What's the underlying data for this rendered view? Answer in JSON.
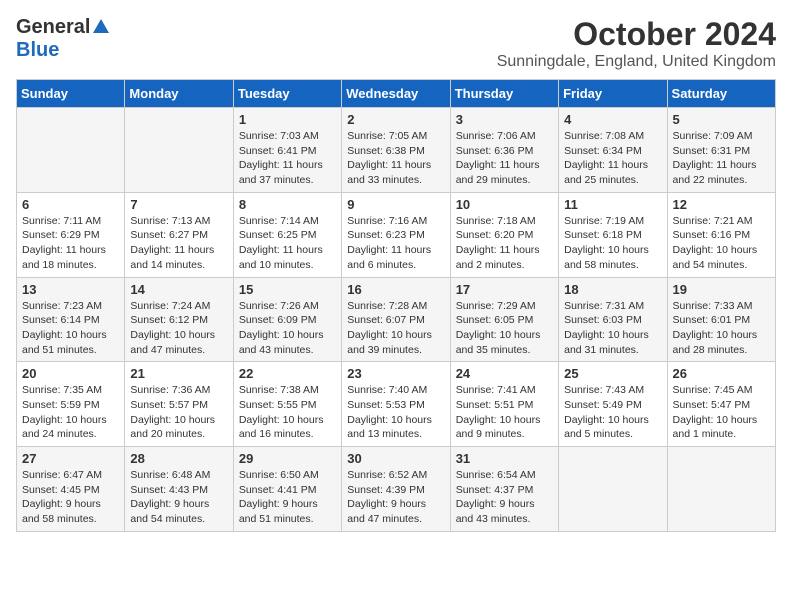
{
  "logo": {
    "general": "General",
    "blue": "Blue"
  },
  "title": "October 2024",
  "subtitle": "Sunningdale, England, United Kingdom",
  "weekdays": [
    "Sunday",
    "Monday",
    "Tuesday",
    "Wednesday",
    "Thursday",
    "Friday",
    "Saturday"
  ],
  "weeks": [
    [
      {
        "day": "",
        "content": ""
      },
      {
        "day": "",
        "content": ""
      },
      {
        "day": "1",
        "content": "Sunrise: 7:03 AM\nSunset: 6:41 PM\nDaylight: 11 hours and 37 minutes."
      },
      {
        "day": "2",
        "content": "Sunrise: 7:05 AM\nSunset: 6:38 PM\nDaylight: 11 hours and 33 minutes."
      },
      {
        "day": "3",
        "content": "Sunrise: 7:06 AM\nSunset: 6:36 PM\nDaylight: 11 hours and 29 minutes."
      },
      {
        "day": "4",
        "content": "Sunrise: 7:08 AM\nSunset: 6:34 PM\nDaylight: 11 hours and 25 minutes."
      },
      {
        "day": "5",
        "content": "Sunrise: 7:09 AM\nSunset: 6:31 PM\nDaylight: 11 hours and 22 minutes."
      }
    ],
    [
      {
        "day": "6",
        "content": "Sunrise: 7:11 AM\nSunset: 6:29 PM\nDaylight: 11 hours and 18 minutes."
      },
      {
        "day": "7",
        "content": "Sunrise: 7:13 AM\nSunset: 6:27 PM\nDaylight: 11 hours and 14 minutes."
      },
      {
        "day": "8",
        "content": "Sunrise: 7:14 AM\nSunset: 6:25 PM\nDaylight: 11 hours and 10 minutes."
      },
      {
        "day": "9",
        "content": "Sunrise: 7:16 AM\nSunset: 6:23 PM\nDaylight: 11 hours and 6 minutes."
      },
      {
        "day": "10",
        "content": "Sunrise: 7:18 AM\nSunset: 6:20 PM\nDaylight: 11 hours and 2 minutes."
      },
      {
        "day": "11",
        "content": "Sunrise: 7:19 AM\nSunset: 6:18 PM\nDaylight: 10 hours and 58 minutes."
      },
      {
        "day": "12",
        "content": "Sunrise: 7:21 AM\nSunset: 6:16 PM\nDaylight: 10 hours and 54 minutes."
      }
    ],
    [
      {
        "day": "13",
        "content": "Sunrise: 7:23 AM\nSunset: 6:14 PM\nDaylight: 10 hours and 51 minutes."
      },
      {
        "day": "14",
        "content": "Sunrise: 7:24 AM\nSunset: 6:12 PM\nDaylight: 10 hours and 47 minutes."
      },
      {
        "day": "15",
        "content": "Sunrise: 7:26 AM\nSunset: 6:09 PM\nDaylight: 10 hours and 43 minutes."
      },
      {
        "day": "16",
        "content": "Sunrise: 7:28 AM\nSunset: 6:07 PM\nDaylight: 10 hours and 39 minutes."
      },
      {
        "day": "17",
        "content": "Sunrise: 7:29 AM\nSunset: 6:05 PM\nDaylight: 10 hours and 35 minutes."
      },
      {
        "day": "18",
        "content": "Sunrise: 7:31 AM\nSunset: 6:03 PM\nDaylight: 10 hours and 31 minutes."
      },
      {
        "day": "19",
        "content": "Sunrise: 7:33 AM\nSunset: 6:01 PM\nDaylight: 10 hours and 28 minutes."
      }
    ],
    [
      {
        "day": "20",
        "content": "Sunrise: 7:35 AM\nSunset: 5:59 PM\nDaylight: 10 hours and 24 minutes."
      },
      {
        "day": "21",
        "content": "Sunrise: 7:36 AM\nSunset: 5:57 PM\nDaylight: 10 hours and 20 minutes."
      },
      {
        "day": "22",
        "content": "Sunrise: 7:38 AM\nSunset: 5:55 PM\nDaylight: 10 hours and 16 minutes."
      },
      {
        "day": "23",
        "content": "Sunrise: 7:40 AM\nSunset: 5:53 PM\nDaylight: 10 hours and 13 minutes."
      },
      {
        "day": "24",
        "content": "Sunrise: 7:41 AM\nSunset: 5:51 PM\nDaylight: 10 hours and 9 minutes."
      },
      {
        "day": "25",
        "content": "Sunrise: 7:43 AM\nSunset: 5:49 PM\nDaylight: 10 hours and 5 minutes."
      },
      {
        "day": "26",
        "content": "Sunrise: 7:45 AM\nSunset: 5:47 PM\nDaylight: 10 hours and 1 minute."
      }
    ],
    [
      {
        "day": "27",
        "content": "Sunrise: 6:47 AM\nSunset: 4:45 PM\nDaylight: 9 hours and 58 minutes."
      },
      {
        "day": "28",
        "content": "Sunrise: 6:48 AM\nSunset: 4:43 PM\nDaylight: 9 hours and 54 minutes."
      },
      {
        "day": "29",
        "content": "Sunrise: 6:50 AM\nSunset: 4:41 PM\nDaylight: 9 hours and 51 minutes."
      },
      {
        "day": "30",
        "content": "Sunrise: 6:52 AM\nSunset: 4:39 PM\nDaylight: 9 hours and 47 minutes."
      },
      {
        "day": "31",
        "content": "Sunrise: 6:54 AM\nSunset: 4:37 PM\nDaylight: 9 hours and 43 minutes."
      },
      {
        "day": "",
        "content": ""
      },
      {
        "day": "",
        "content": ""
      }
    ]
  ]
}
